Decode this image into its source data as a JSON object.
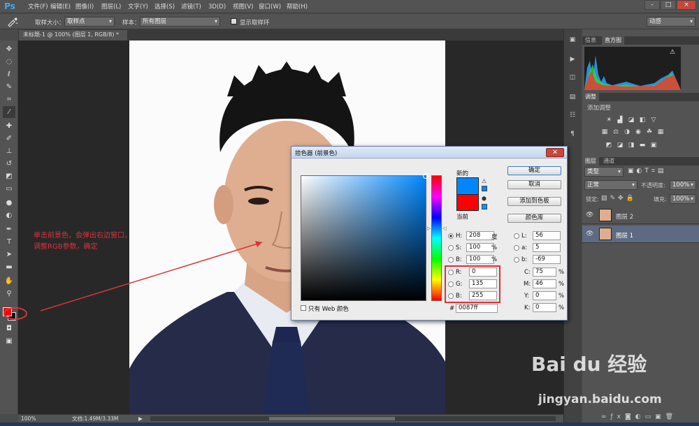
{
  "app": {
    "logo": "Ps"
  },
  "menus": [
    "文件(F)",
    "编辑(E)",
    "图像(I)",
    "图层(L)",
    "文字(Y)",
    "选择(S)",
    "滤镜(T)",
    "3D(D)",
    "视图(V)",
    "窗口(W)",
    "帮助(H)"
  ],
  "window_buttons": {
    "minimize": "-",
    "restore": "□",
    "close": "×"
  },
  "options_bar": {
    "sample_size_label": "取样大小：",
    "sample_size_value": "取样点",
    "sample_label": "样本：",
    "sample_value": "所有图层",
    "show_ring_label": "显示取样环",
    "workspace": "动感"
  },
  "document_tab": {
    "title": "未标题-1 @ 100% (图层 1, RGB/8) *",
    "close": "×"
  },
  "status_bar": {
    "zoom": "100%",
    "doc_info": "文档:1.49M/3.33M"
  },
  "panels": {
    "top_tabs": [
      "信息",
      "直方图"
    ],
    "adjust_tab": "调整",
    "adjust_title": "添加调整",
    "layer_tabs": [
      "图层",
      "通道"
    ],
    "kind_filter": "类型",
    "blend_mode": "正常",
    "opacity_label": "不透明度:",
    "opacity_value": "100%",
    "lock_label": "锁定:",
    "fill_label": "填充:",
    "fill_value": "100%",
    "layers": [
      {
        "name": "图层 2",
        "selected": false
      },
      {
        "name": "图层 1",
        "selected": true
      }
    ]
  },
  "dialog": {
    "title": "拾色器 (前景色)",
    "close": "×",
    "new_label": "新的",
    "current_label": "当前",
    "buttons": {
      "ok": "确定",
      "cancel": "取消",
      "add_swatch": "添加到色板",
      "libraries": "颜色库"
    },
    "web_only_label": "只有 Web 颜色",
    "hsb": {
      "H": "208",
      "H_unit": "度",
      "S": "100",
      "S_unit": "%",
      "B": "100",
      "B_unit": "%"
    },
    "lab": {
      "L": "56",
      "a": "5",
      "b": "-69"
    },
    "rgb": {
      "R": "0",
      "G": "135",
      "B": "255"
    },
    "cmyk": {
      "C": "75",
      "M": "46",
      "Y": "0",
      "K": "0",
      "unit": "%"
    },
    "hex_label": "#",
    "hex": "0087ff",
    "colors": {
      "new": "#0087ff",
      "current": "#ff0000"
    }
  },
  "annotation": {
    "text1": "单击前景色，会弹出右边窗口，",
    "text2": "调整RGB参数，确定"
  },
  "watermark": {
    "text": "Bai du 经验",
    "url": "jingyan.baidu.com"
  },
  "colors": {
    "accent_red": "#d8343b",
    "bg": "#535353"
  }
}
